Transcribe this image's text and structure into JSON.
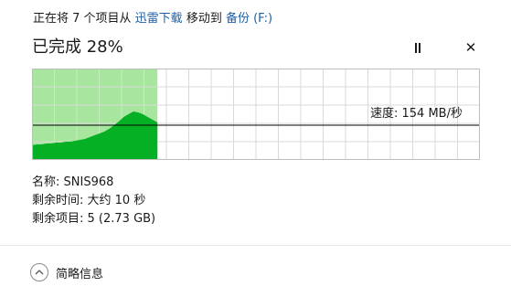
{
  "header": {
    "prefix": "正在将 7 个项目从 ",
    "source": "迅雷下载",
    "middle": " 移动到 ",
    "destination": "备份 (F:)"
  },
  "progress": {
    "label": "已完成 28%",
    "percent": 28
  },
  "controls": {
    "pause_icon": "pause-icon",
    "close_symbol": "✕"
  },
  "graph": {
    "speed_label": "速度: 154 MB/秒",
    "fill_color": "#06b025",
    "background_fill_color": "#a8e6a0",
    "grid_color": "#d9d9d9",
    "line_color": "#000000",
    "history": [
      [
        0.0,
        0.16
      ],
      [
        0.02,
        0.17
      ],
      [
        0.04,
        0.17
      ],
      [
        0.06,
        0.18
      ],
      [
        0.08,
        0.18
      ],
      [
        0.1,
        0.19
      ],
      [
        0.12,
        0.19
      ],
      [
        0.14,
        0.2
      ],
      [
        0.16,
        0.2
      ],
      [
        0.18,
        0.21
      ],
      [
        0.2,
        0.22
      ],
      [
        0.22,
        0.23
      ],
      [
        0.24,
        0.25
      ],
      [
        0.26,
        0.27
      ],
      [
        0.28,
        0.29
      ],
      [
        0.3,
        0.31
      ],
      [
        0.32,
        0.34
      ],
      [
        0.34,
        0.38
      ],
      [
        0.36,
        0.42
      ],
      [
        0.38,
        0.47
      ],
      [
        0.4,
        0.5
      ],
      [
        0.42,
        0.53
      ],
      [
        0.44,
        0.52
      ],
      [
        0.46,
        0.5
      ],
      [
        0.48,
        0.47
      ],
      [
        0.5,
        0.44
      ],
      [
        0.52,
        0.41
      ]
    ],
    "current_speed_level": 0.38
  },
  "details": {
    "name": "名称: SNIS968",
    "time_remaining": "剩余时间: 大约 10 秒",
    "items_remaining": "剩余项目: 5 (2.73 GB)"
  },
  "footer": {
    "label": "简略信息"
  }
}
